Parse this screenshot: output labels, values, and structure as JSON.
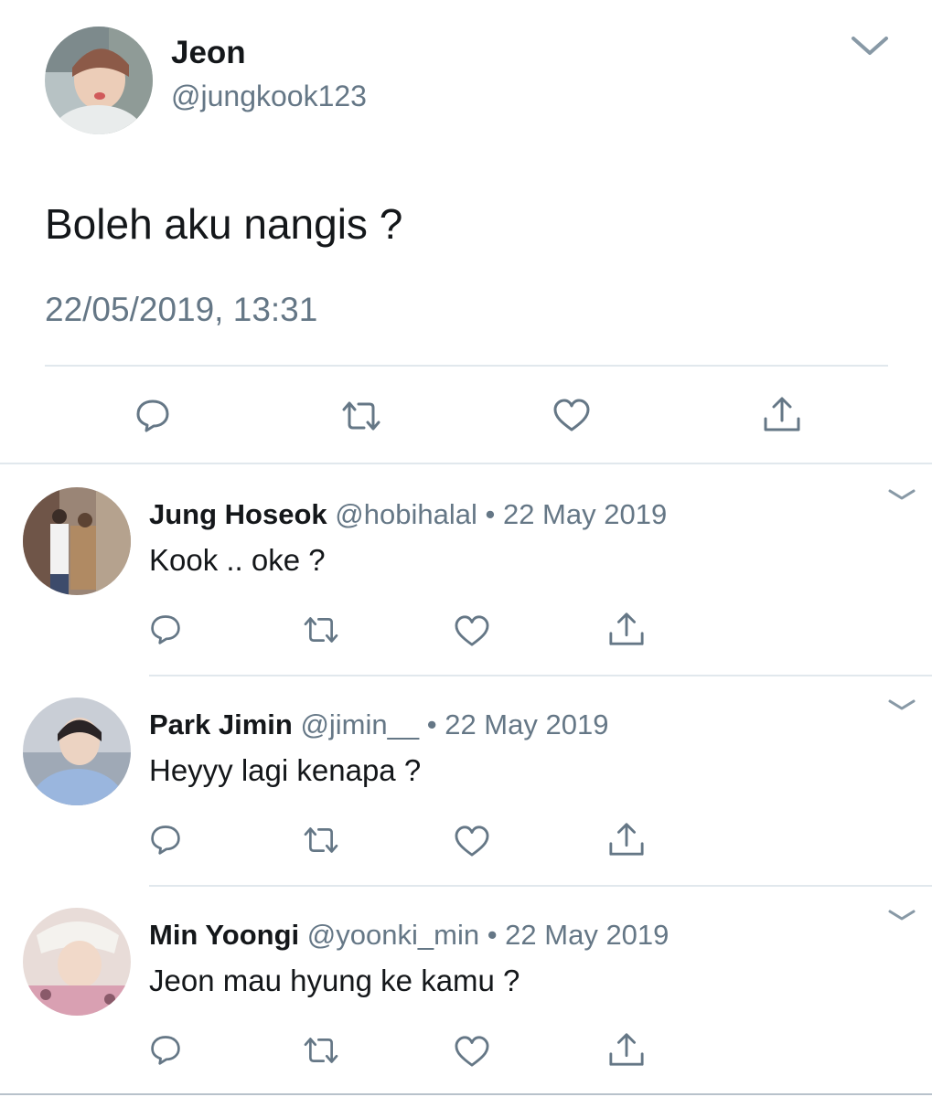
{
  "tweet": {
    "display_name": "Jeon",
    "handle": "@jungkook123",
    "text": "Boleh aku nangis ?",
    "timestamp": "22/05/2019, 13:31"
  },
  "replies": [
    {
      "display_name": "Jung Hoseok",
      "handle": "@hobihalal",
      "date": "• 22 May 2019",
      "text": "Kook .. oke ?"
    },
    {
      "display_name": "Park Jimin",
      "handle": "@jimin__",
      "date": "• 22 May 2019",
      "text": "Heyyy lagi kenapa ?"
    },
    {
      "display_name": "Min Yoongi",
      "handle": "@yoonki_min",
      "date": "• 22 May 2019",
      "text": "Jeon mau hyung ke kamu ?"
    }
  ],
  "icons": {
    "reply": "reply-icon",
    "retweet": "retweet-icon",
    "like": "heart-icon",
    "share": "share-icon",
    "more": "chevron-down-icon"
  },
  "colors": {
    "text_primary": "#14171a",
    "text_secondary": "#657786",
    "icon": "#657786",
    "divider": "#e1e8ed"
  }
}
